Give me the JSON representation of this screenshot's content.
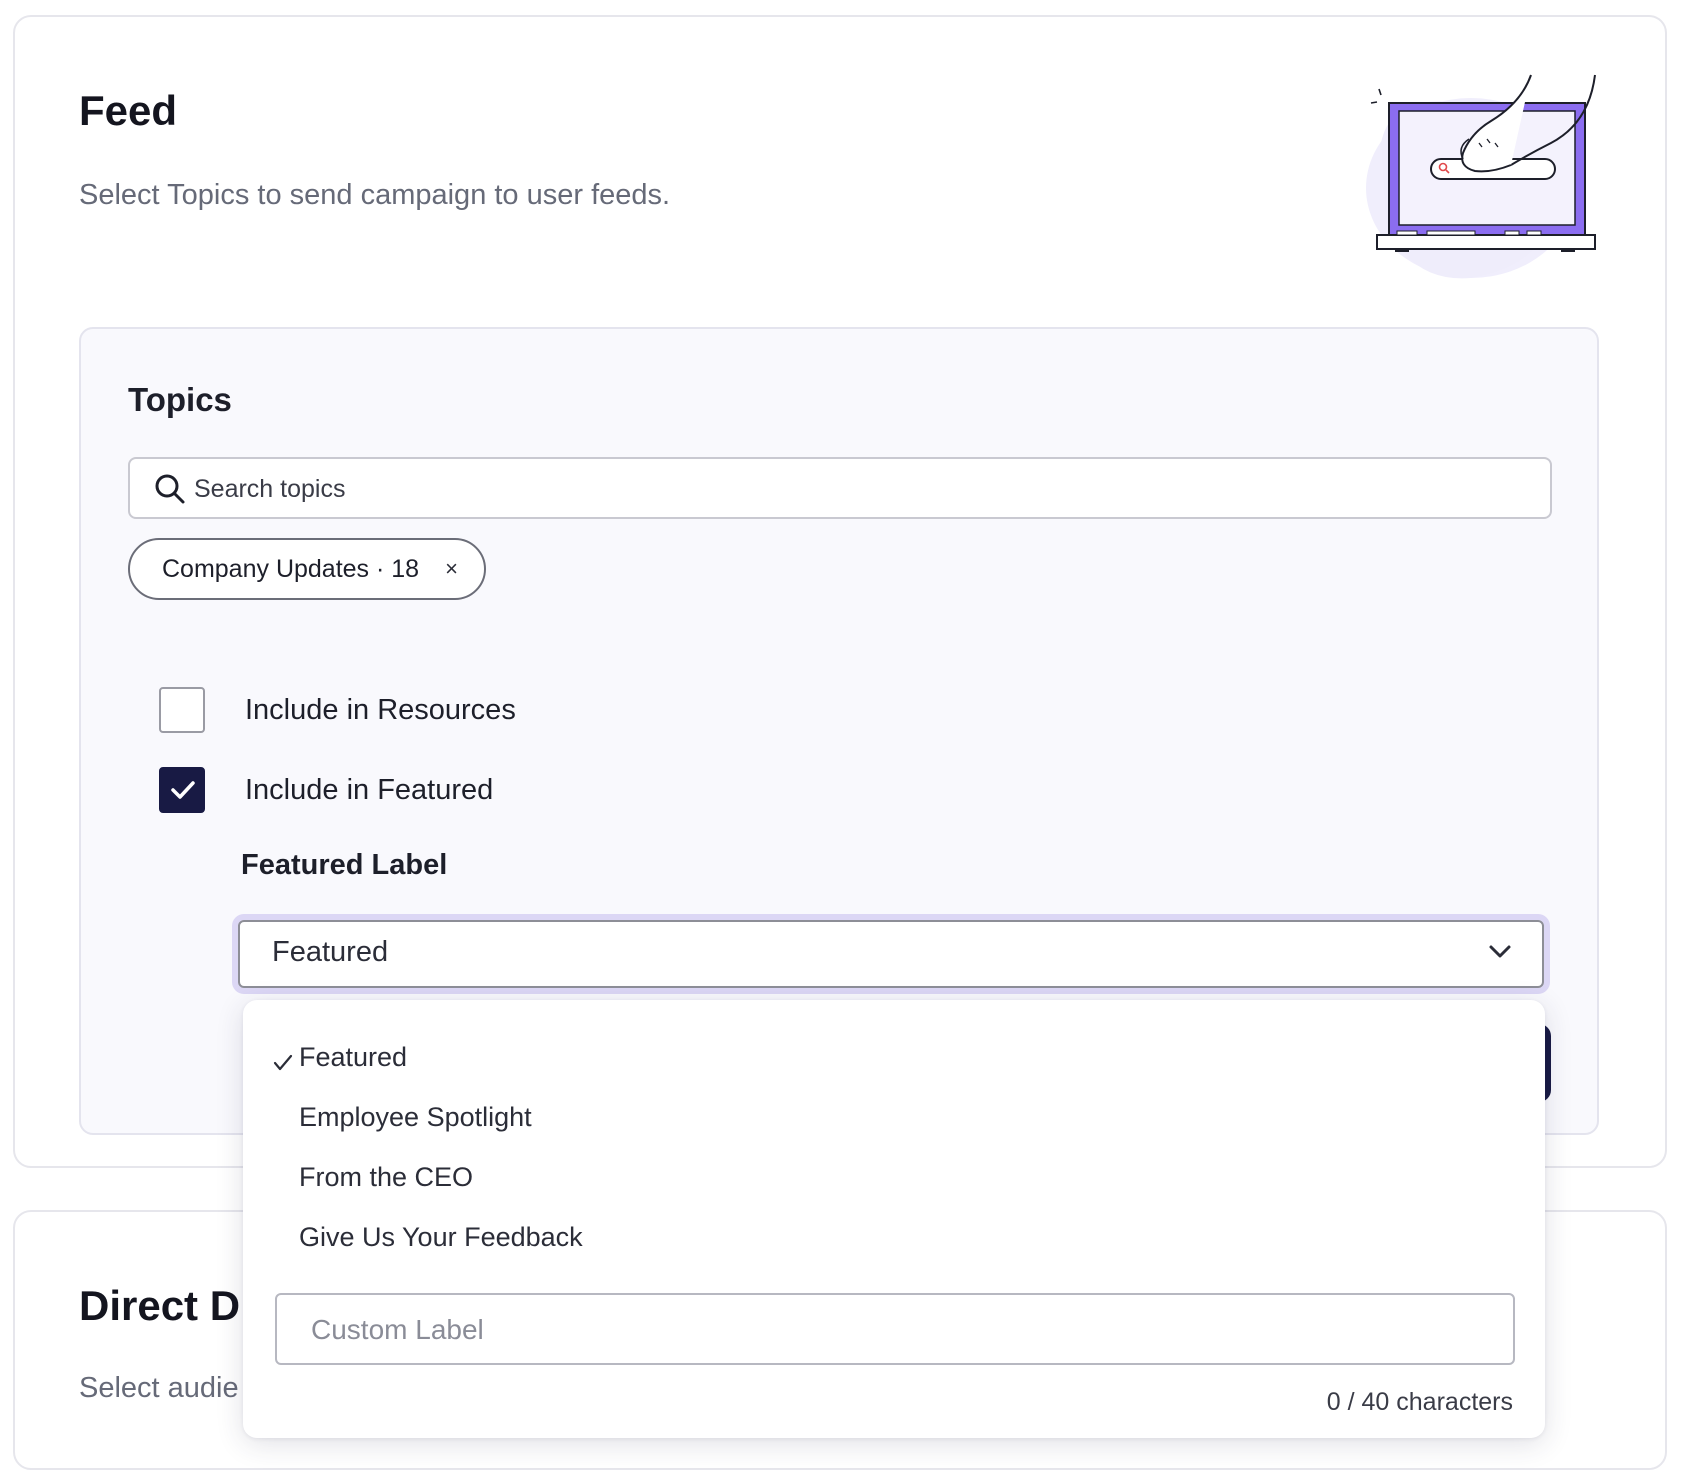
{
  "feed": {
    "title": "Feed",
    "subtitle": "Select Topics to send campaign to user feeds.",
    "topics": {
      "title": "Topics",
      "search_placeholder": "Search topics",
      "chips": [
        {
          "label": "Company Updates · 18",
          "remove": "×"
        }
      ],
      "checkboxes": [
        {
          "label": "Include in Resources",
          "checked": false
        },
        {
          "label": "Include in Featured",
          "checked": true
        }
      ],
      "featured_label": {
        "title": "Featured Label",
        "selected": "Featured",
        "options": [
          "Featured",
          "Employee Spotlight",
          "From the CEO",
          "Give Us Your Feedback"
        ],
        "custom_placeholder": "Custom Label",
        "char_count": "0 / 40 characters"
      }
    }
  },
  "direct": {
    "title_visible": "Direct D",
    "subtitle_visible": "Select audie"
  },
  "colors": {
    "accent_dark": "#181a44",
    "illustration_purple": "#8b6df0",
    "focus_ring": "#dcd7f5"
  }
}
